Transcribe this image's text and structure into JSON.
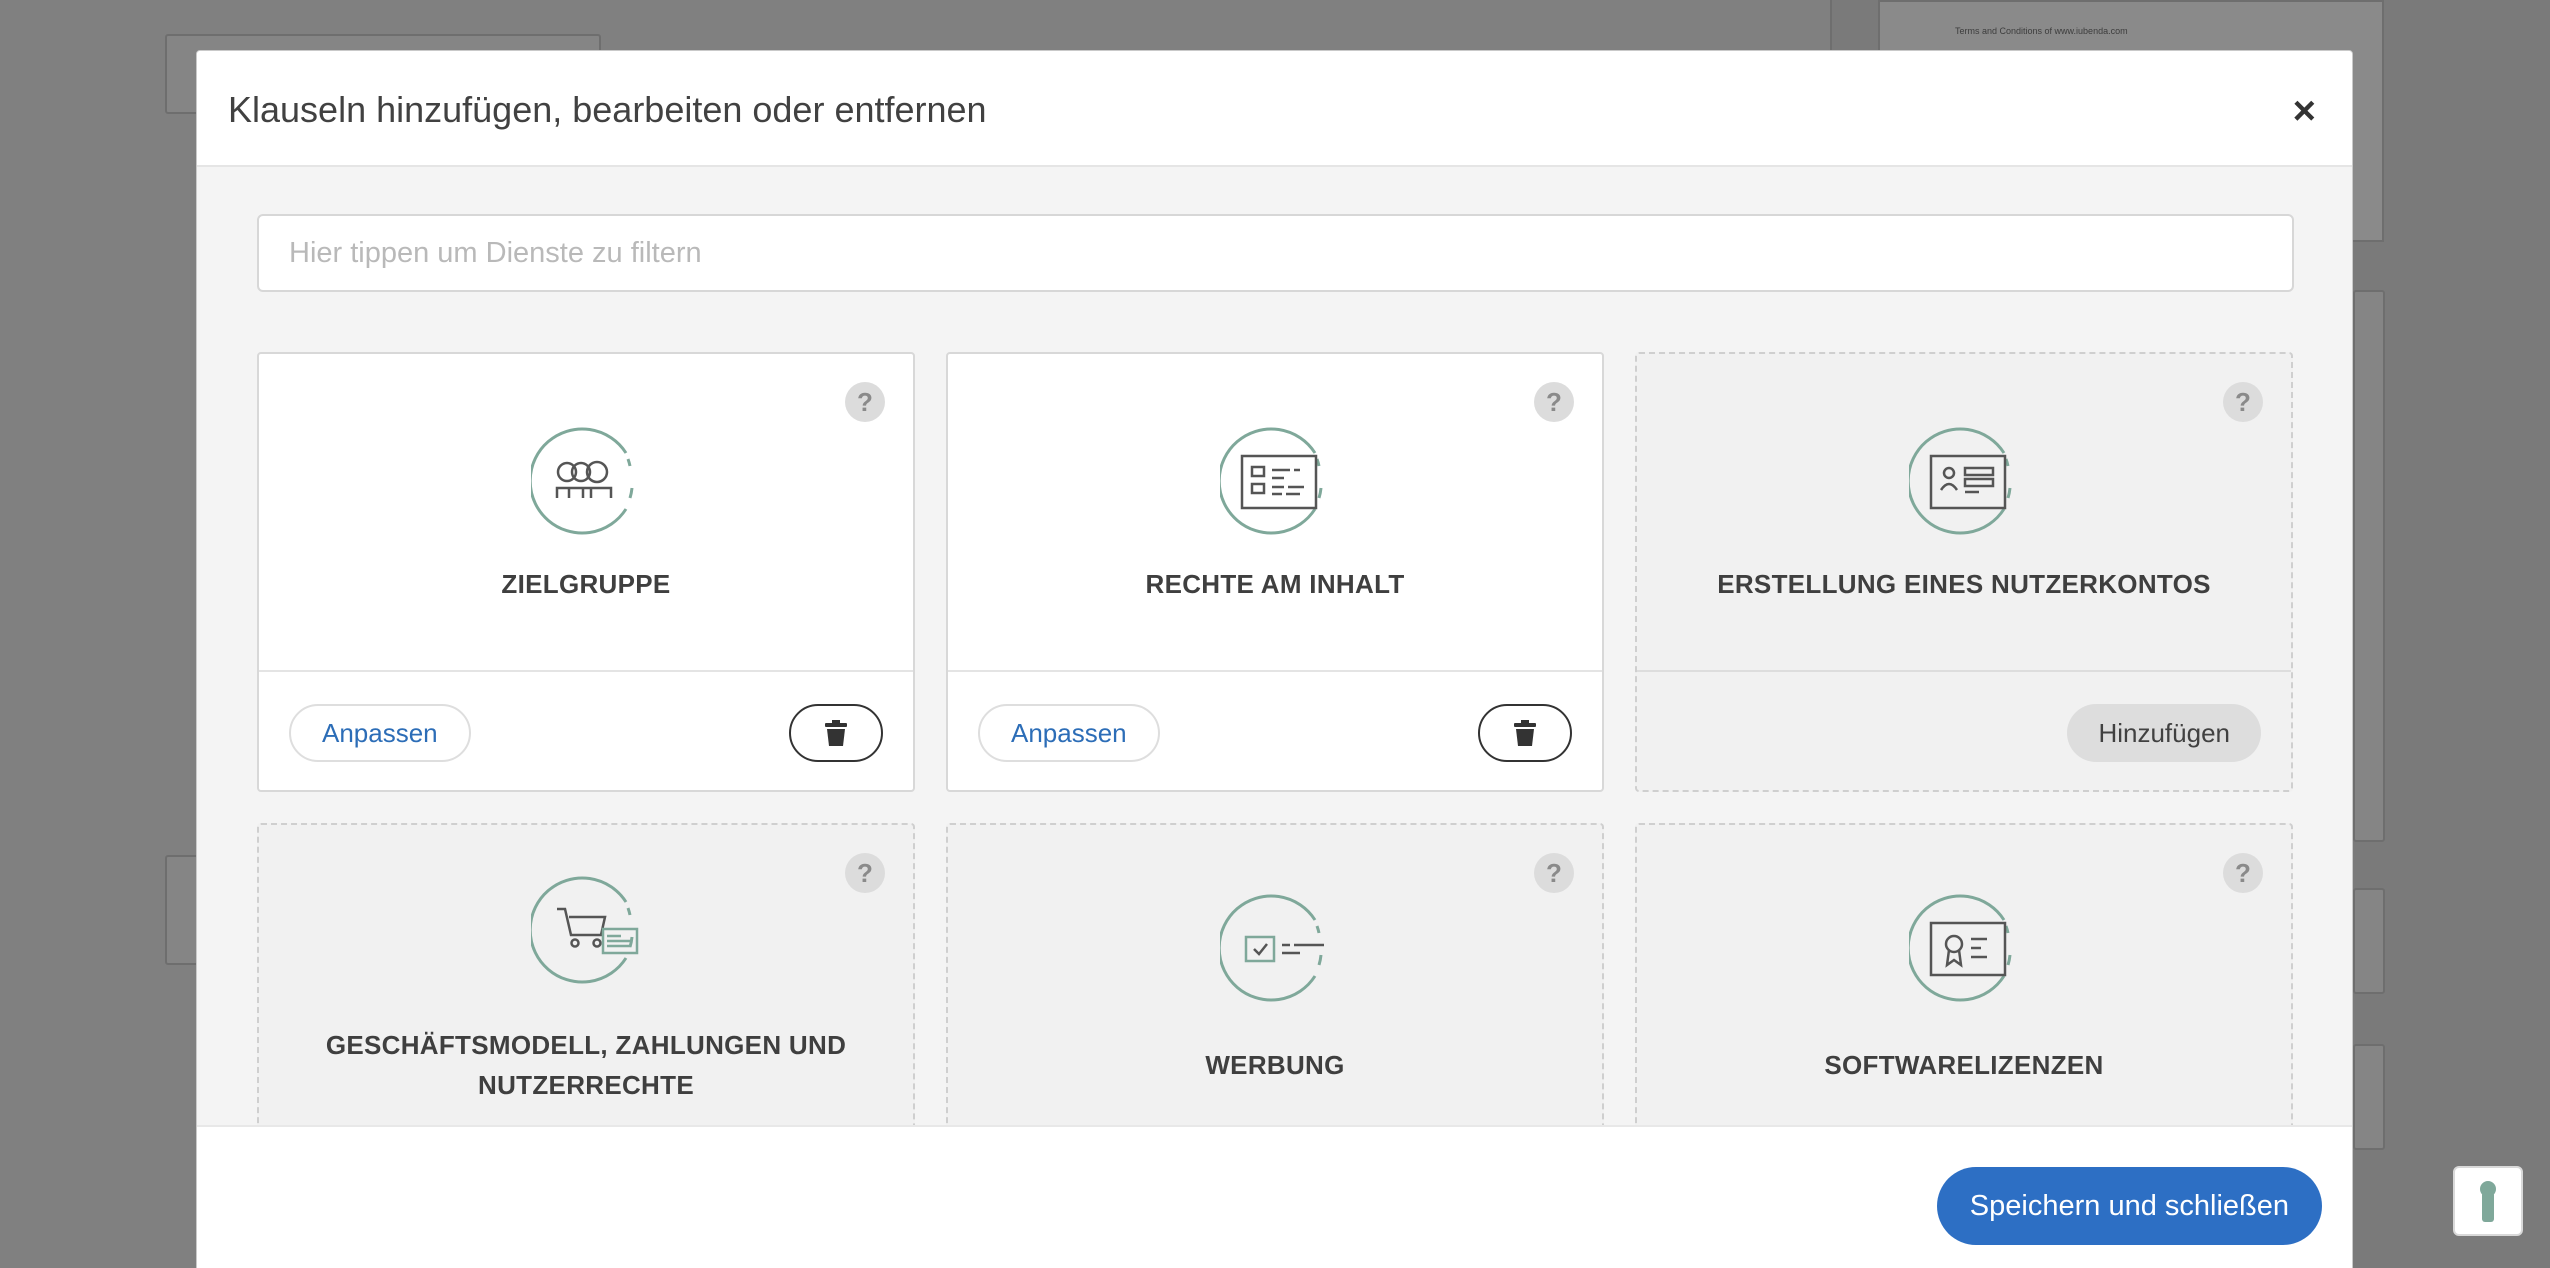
{
  "modal": {
    "title": "Klauseln hinzufügen, bearbeiten oder entfernen",
    "close_label": "×",
    "filter_placeholder": "Hier tippen um Dienste zu filtern",
    "filter_value": "",
    "save_label": "Speichern und schließen"
  },
  "background": {
    "terms_text": "Terms and Conditions of www.iubenda.com"
  },
  "cards": [
    {
      "title": "ZIELGRUPPE",
      "icon": "audience-icon",
      "status": "active",
      "help": "?",
      "customize_label": "Anpassen",
      "delete_icon": "trash-icon"
    },
    {
      "title": "RECHTE AM INHALT",
      "icon": "content-rights-icon",
      "status": "active",
      "help": "?",
      "customize_label": "Anpassen",
      "delete_icon": "trash-icon"
    },
    {
      "title": "ERSTELLUNG EINES NUTZERKONTOS",
      "icon": "user-account-icon",
      "status": "inactive",
      "help": "?",
      "add_label": "Hinzufügen"
    },
    {
      "title_line1": "GESCHÄFTSMODELL, ZAHLUNGEN UND",
      "title_line2": "NUTZERRECHTE",
      "icon": "shopping-cart-icon",
      "status": "inactive",
      "help": "?"
    },
    {
      "title": "WERBUNG",
      "icon": "advertising-icon",
      "status": "inactive",
      "help": "?"
    },
    {
      "title": "SOFTWARELIZENZEN",
      "icon": "software-license-icon",
      "status": "inactive",
      "help": "?"
    }
  ],
  "colors": {
    "accent": "#2d6fc4",
    "icon_green": "#7fa89a",
    "overlay": "#808080"
  }
}
